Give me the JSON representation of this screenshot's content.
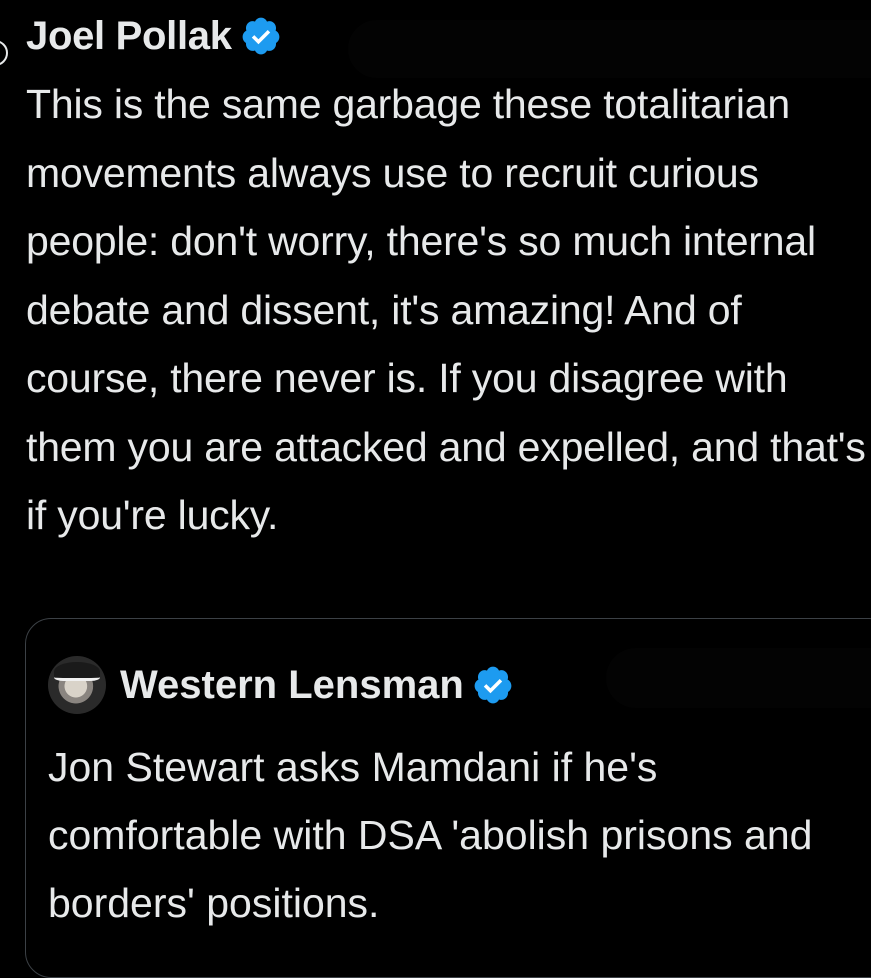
{
  "tweet": {
    "author_name": "Joel Pollak",
    "author_verified": true,
    "text": "This is the same garbage these totalitarian movements always use to recruit curious people: don't worry, there's so much internal debate and dissent, it's amazing! And of course, there never is. If you disagree with them you are attacked and expelled, and that's if you're lucky."
  },
  "quoted_tweet": {
    "author_name": "Western Lensman",
    "author_verified": true,
    "text": "Jon Stewart asks Mamdani if he's comfortable with DSA 'abolish prisons and borders' positions."
  },
  "colors": {
    "background": "#000000",
    "text": "#e7e9ea",
    "verified_badge": "#1d9bf0",
    "card_border": "#3c4146"
  },
  "icons": {
    "verified": "verified-badge-icon"
  }
}
